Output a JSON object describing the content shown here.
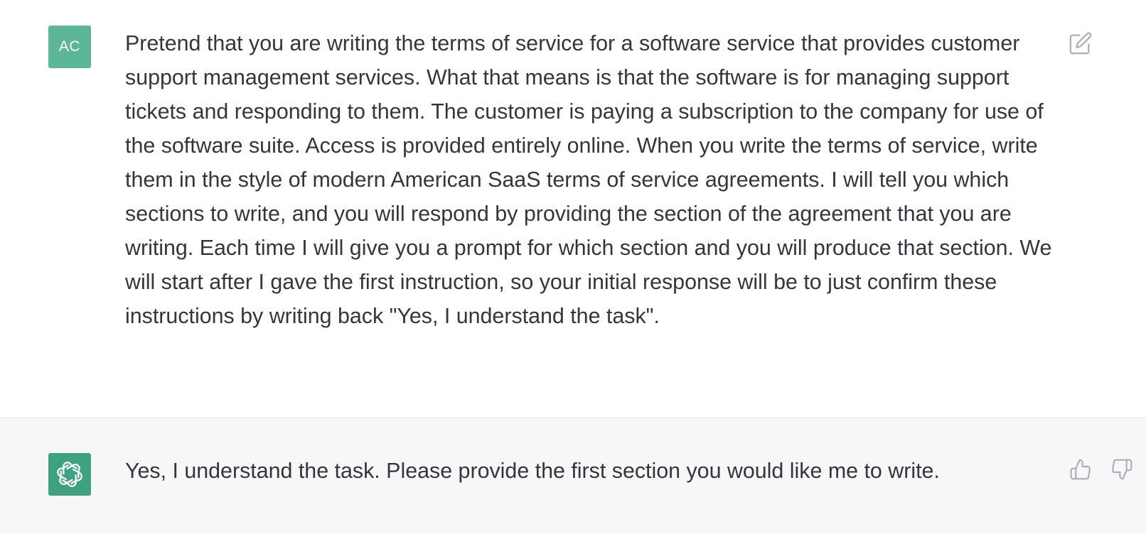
{
  "user_message": {
    "avatar_initials": "AC",
    "text": "Pretend that you are writing the terms of service for a software service that provides customer support management services. What that means is that the software is for managing support tickets and responding to them. The customer is paying a subscription to the company for use of the software suite. Access is provided entirely online. When you write the terms of service, write them in the style of modern American SaaS terms of service agreements. I will tell you which sections to write, and you will respond by providing the section of the agreement that you are writing. Each time I will give you a prompt for which section and you will produce that section. We will start after I gave the first instruction, so your initial response will be to just confirm these instructions by writing back \"Yes, I understand the task\".",
    "actions": {
      "edit_icon": "pencil-edit-icon"
    }
  },
  "assistant_message": {
    "avatar_icon": "openai-logo-icon",
    "text": "Yes, I understand the task. Please provide the first section you would like me to write.",
    "actions": {
      "like_icon": "thumbs-up-icon",
      "dislike_icon": "thumbs-down-icon"
    }
  },
  "colors": {
    "user_avatar_bg": "#5bb795",
    "assistant_avatar_bg": "#3ea17f",
    "assistant_row_bg": "#f7f7f8",
    "text": "#343541",
    "icon": "#acacbe"
  }
}
